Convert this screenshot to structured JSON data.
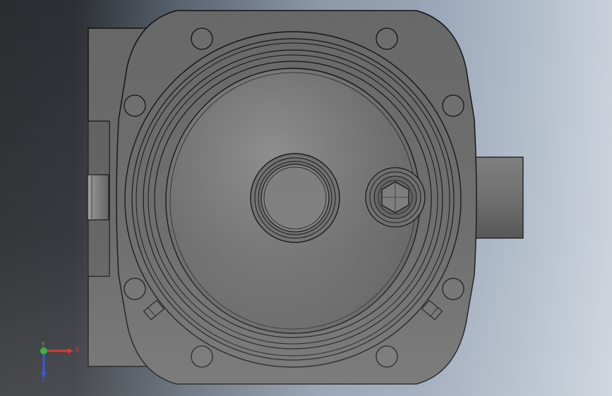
{
  "viewport": {
    "background_left": "#2a2c30",
    "background_right": "#c9d0da",
    "part_color": "#6b6b6b",
    "edge_color": "#111111"
  },
  "triad": {
    "x_label": "X",
    "y_label": "Y",
    "z_label": "Z",
    "x_color": "#d11f1f",
    "y_color": "#27a52b",
    "z_color": "#1f3fd1"
  }
}
